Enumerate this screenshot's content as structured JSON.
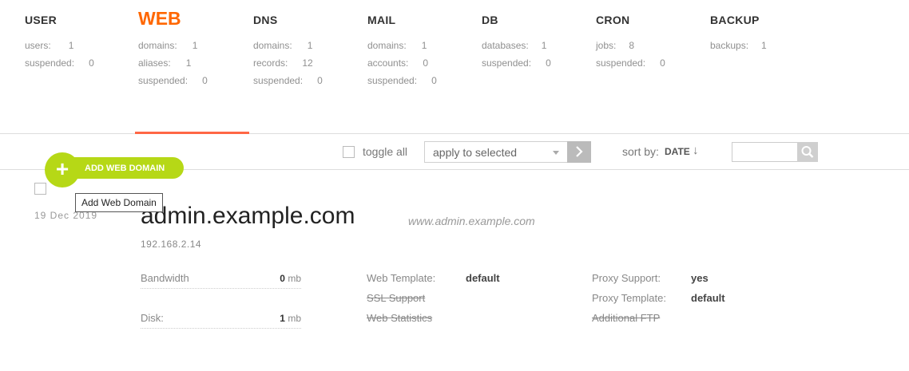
{
  "stats": [
    {
      "title": "USER",
      "rows": [
        {
          "label": "users:",
          "value": "1"
        },
        {
          "label": "suspended:",
          "value": "0"
        }
      ]
    },
    {
      "title": "WEB",
      "rows": [
        {
          "label": "domains:",
          "value": "1"
        },
        {
          "label": "aliases:",
          "value": "1"
        },
        {
          "label": "suspended:",
          "value": "0"
        }
      ]
    },
    {
      "title": "DNS",
      "rows": [
        {
          "label": "domains:",
          "value": "1"
        },
        {
          "label": "records:",
          "value": "12"
        },
        {
          "label": "suspended:",
          "value": "0"
        }
      ]
    },
    {
      "title": "MAIL",
      "rows": [
        {
          "label": "domains:",
          "value": "1"
        },
        {
          "label": "accounts:",
          "value": "0"
        },
        {
          "label": "suspended:",
          "value": "0"
        }
      ]
    },
    {
      "title": "DB",
      "rows": [
        {
          "label": "databases:",
          "value": "1"
        },
        {
          "label": "suspended:",
          "value": "0"
        }
      ]
    },
    {
      "title": "CRON",
      "rows": [
        {
          "label": "jobs:",
          "value": "8"
        },
        {
          "label": "suspended:",
          "value": "0"
        }
      ]
    },
    {
      "title": "BACKUP",
      "rows": [
        {
          "label": "backups:",
          "value": "1"
        }
      ]
    }
  ],
  "toolbar": {
    "toggle_all": "toggle all",
    "apply_selected": "apply to selected",
    "go_icon": "chevron-right-icon",
    "sort_by": "sort by:",
    "sort_value": "DATE",
    "sort_arrow": "↓",
    "search_icon": "search-icon"
  },
  "add_button": {
    "label": "ADD WEB DOMAIN",
    "tooltip": "Add Web Domain"
  },
  "domain": {
    "date": "19  Dec  2019",
    "name": "admin.example.com",
    "alias": "www.admin.example.com",
    "ip": "192.168.2.14",
    "bandwidth": {
      "label": "Bandwidth",
      "value": "0",
      "unit": "mb"
    },
    "disk": {
      "label": "Disk:",
      "value": "1",
      "unit": "mb"
    },
    "web_template": {
      "label": "Web Template:",
      "value": "default"
    },
    "ssl_support": "SSL Support",
    "web_statistics": "Web Statistics",
    "proxy_support": {
      "label": "Proxy Support:",
      "value": "yes"
    },
    "proxy_template": {
      "label": "Proxy Template:",
      "value": "default"
    },
    "additional_ftp": "Additional FTP"
  },
  "colors": {
    "accent": "#ff6701",
    "underline": "#ff6745",
    "add_button": "#b6d816"
  }
}
